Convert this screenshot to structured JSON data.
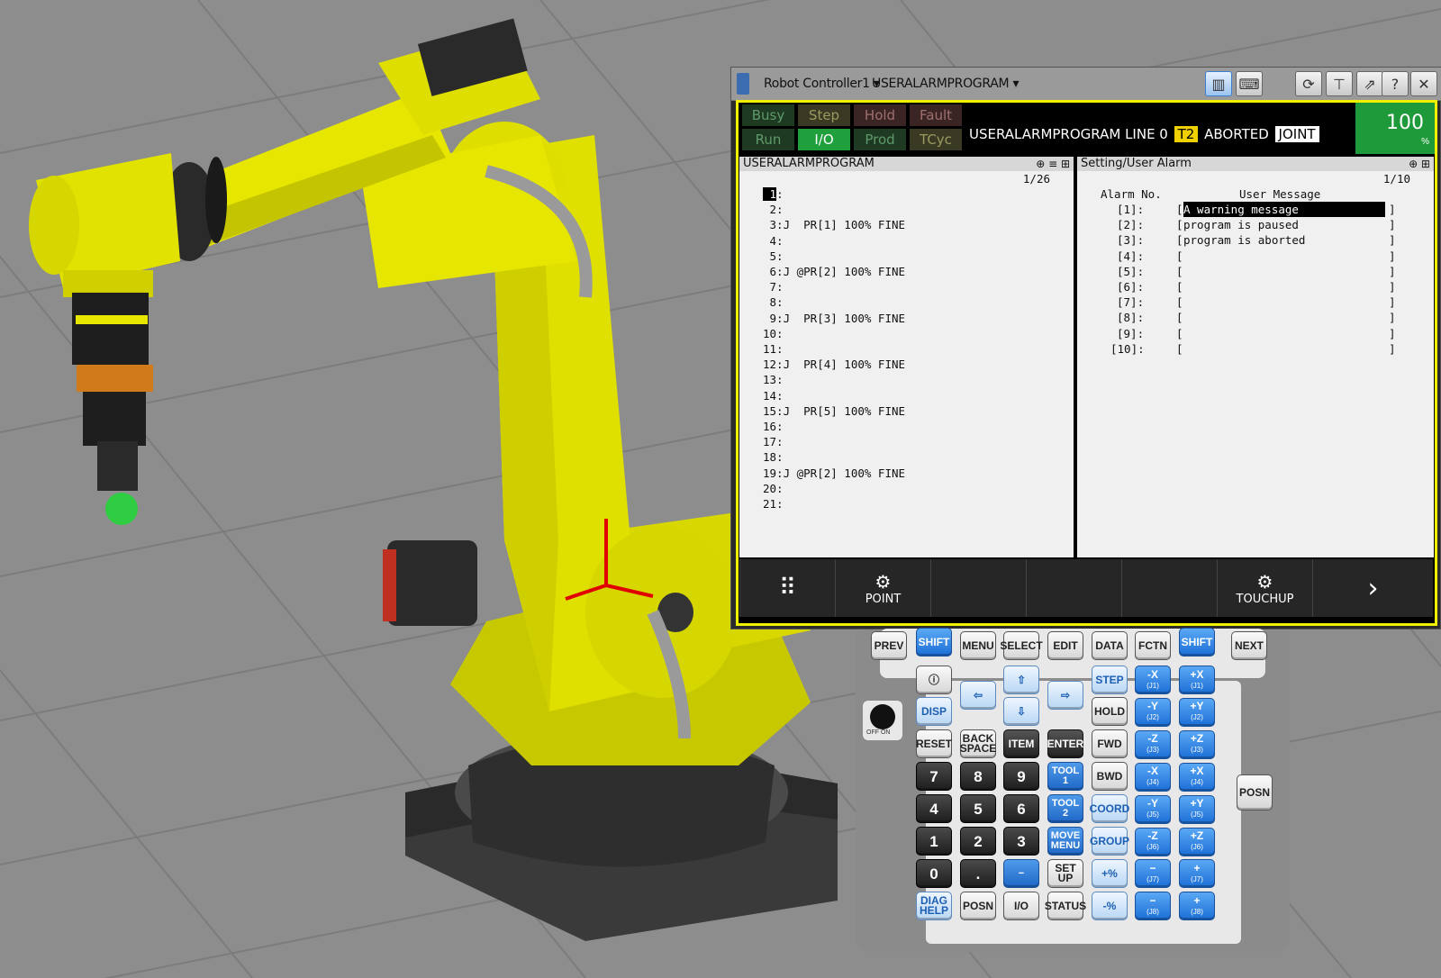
{
  "titlebar": {
    "controller": "Robot Controller1",
    "program": "USERALARMPROGRAM"
  },
  "status_flags": [
    {
      "label": "Busy",
      "lit": false
    },
    {
      "label": "Step",
      "lit": false
    },
    {
      "label": "Hold",
      "lit": false
    },
    {
      "label": "Fault",
      "lit": false
    },
    {
      "label": "Run",
      "lit": false
    },
    {
      "label": "I/O",
      "lit": true
    },
    {
      "label": "Prod",
      "lit": false
    },
    {
      "label": "TCyc",
      "lit": false
    }
  ],
  "status_line": {
    "text": "USERALARMPROGRAM LINE 0",
    "mode": "T2",
    "state": "ABORTED",
    "coord": "JOINT"
  },
  "override": {
    "value": "100",
    "unit": "%"
  },
  "program_pane": {
    "title": "USERALARMPROGRAM",
    "page": "1/26",
    "lines": [
      " 1:",
      " 2:",
      " 3:J  PR[1] 100% FINE",
      " 4:",
      " 5:",
      " 6:J @PR[2] 100% FINE",
      " 7:",
      " 8:",
      " 9:J  PR[3] 100% FINE",
      "10:",
      "11:",
      "12:J  PR[4] 100% FINE",
      "13:",
      "14:",
      "15:J  PR[5] 100% FINE",
      "16:",
      "17:",
      "18:",
      "19:J @PR[2] 100% FINE",
      "20:",
      "21:"
    ]
  },
  "alarm_pane": {
    "title": "Setting/User Alarm",
    "page": "1/10",
    "col_no": "Alarm No.",
    "col_msg": "User Message",
    "rows": [
      {
        "no": "[1]:",
        "msg": "A warning message"
      },
      {
        "no": "[2]:",
        "msg": "program is paused"
      },
      {
        "no": "[3]:",
        "msg": "program is aborted"
      },
      {
        "no": "[4]:",
        "msg": ""
      },
      {
        "no": "[5]:",
        "msg": ""
      },
      {
        "no": "[6]:",
        "msg": ""
      },
      {
        "no": "[7]:",
        "msg": ""
      },
      {
        "no": "[8]:",
        "msg": ""
      },
      {
        "no": "[9]:",
        "msg": ""
      },
      {
        "no": "[10]:",
        "msg": ""
      }
    ]
  },
  "function_keys": {
    "f1": "POINT",
    "f5": "TOUCHUP"
  },
  "keys": {
    "prev": "PREV",
    "shift": "SHIFT",
    "menu": "MENU",
    "select": "SELECT",
    "edit": "EDIT",
    "data": "DATA",
    "fctn": "FCTN",
    "next": "NEXT",
    "disp": "DISP",
    "step": "STEP",
    "hold": "HOLD",
    "reset": "RESET",
    "back1": "BACK",
    "back2": "SPACE",
    "item": "ITEM",
    "enter": "ENTER",
    "fwd": "FWD",
    "bwd": "BWD",
    "coord": "COORD",
    "group": "GROUP",
    "tool": "TOOL",
    "tool1": "1",
    "tool2": "2",
    "move1": "MOVE",
    "move2": "MENU",
    "set": "SET",
    "up": "UP",
    "diag": "DIAG",
    "help": "HELP",
    "posn": "POSN",
    "io": "I/O",
    "status": "STATUS",
    "off": "OFF",
    "on": "ON",
    "n7": "7",
    "n8": "8",
    "n9": "9",
    "n4": "4",
    "n5": "5",
    "n6": "6",
    "n1": "1",
    "n2": "2",
    "n3": "3",
    "n0": "0",
    "dot": ".",
    "dash": "−",
    "pplus": "+%",
    "pminus": "-%",
    "jog": [
      {
        "l": "-X",
        "s": "(J1)"
      },
      {
        "l": "+X",
        "s": "(J1)"
      },
      {
        "l": "-Y",
        "s": "(J2)"
      },
      {
        "l": "+Y",
        "s": "(J2)"
      },
      {
        "l": "-Z",
        "s": "(J3)"
      },
      {
        "l": "+Z",
        "s": "(J3)"
      },
      {
        "l": "-X",
        "s": "(J4)"
      },
      {
        "l": "+X",
        "s": "(J4)"
      },
      {
        "l": "-Y",
        "s": "(J5)"
      },
      {
        "l": "+Y",
        "s": "(J5)"
      },
      {
        "l": "-Z",
        "s": "(J6)"
      },
      {
        "l": "+Z",
        "s": "(J6)"
      },
      {
        "l": "−",
        "s": "(J7)"
      },
      {
        "l": "+",
        "s": "(J7)"
      },
      {
        "l": "−",
        "s": "(J8)"
      },
      {
        "l": "+",
        "s": "(J8)"
      }
    ]
  },
  "colors": {
    "robot": "#e6e600",
    "screen_border": "#f0f000",
    "key_blue": "#1c6fd6",
    "status_lit": "#1f9a3a"
  }
}
